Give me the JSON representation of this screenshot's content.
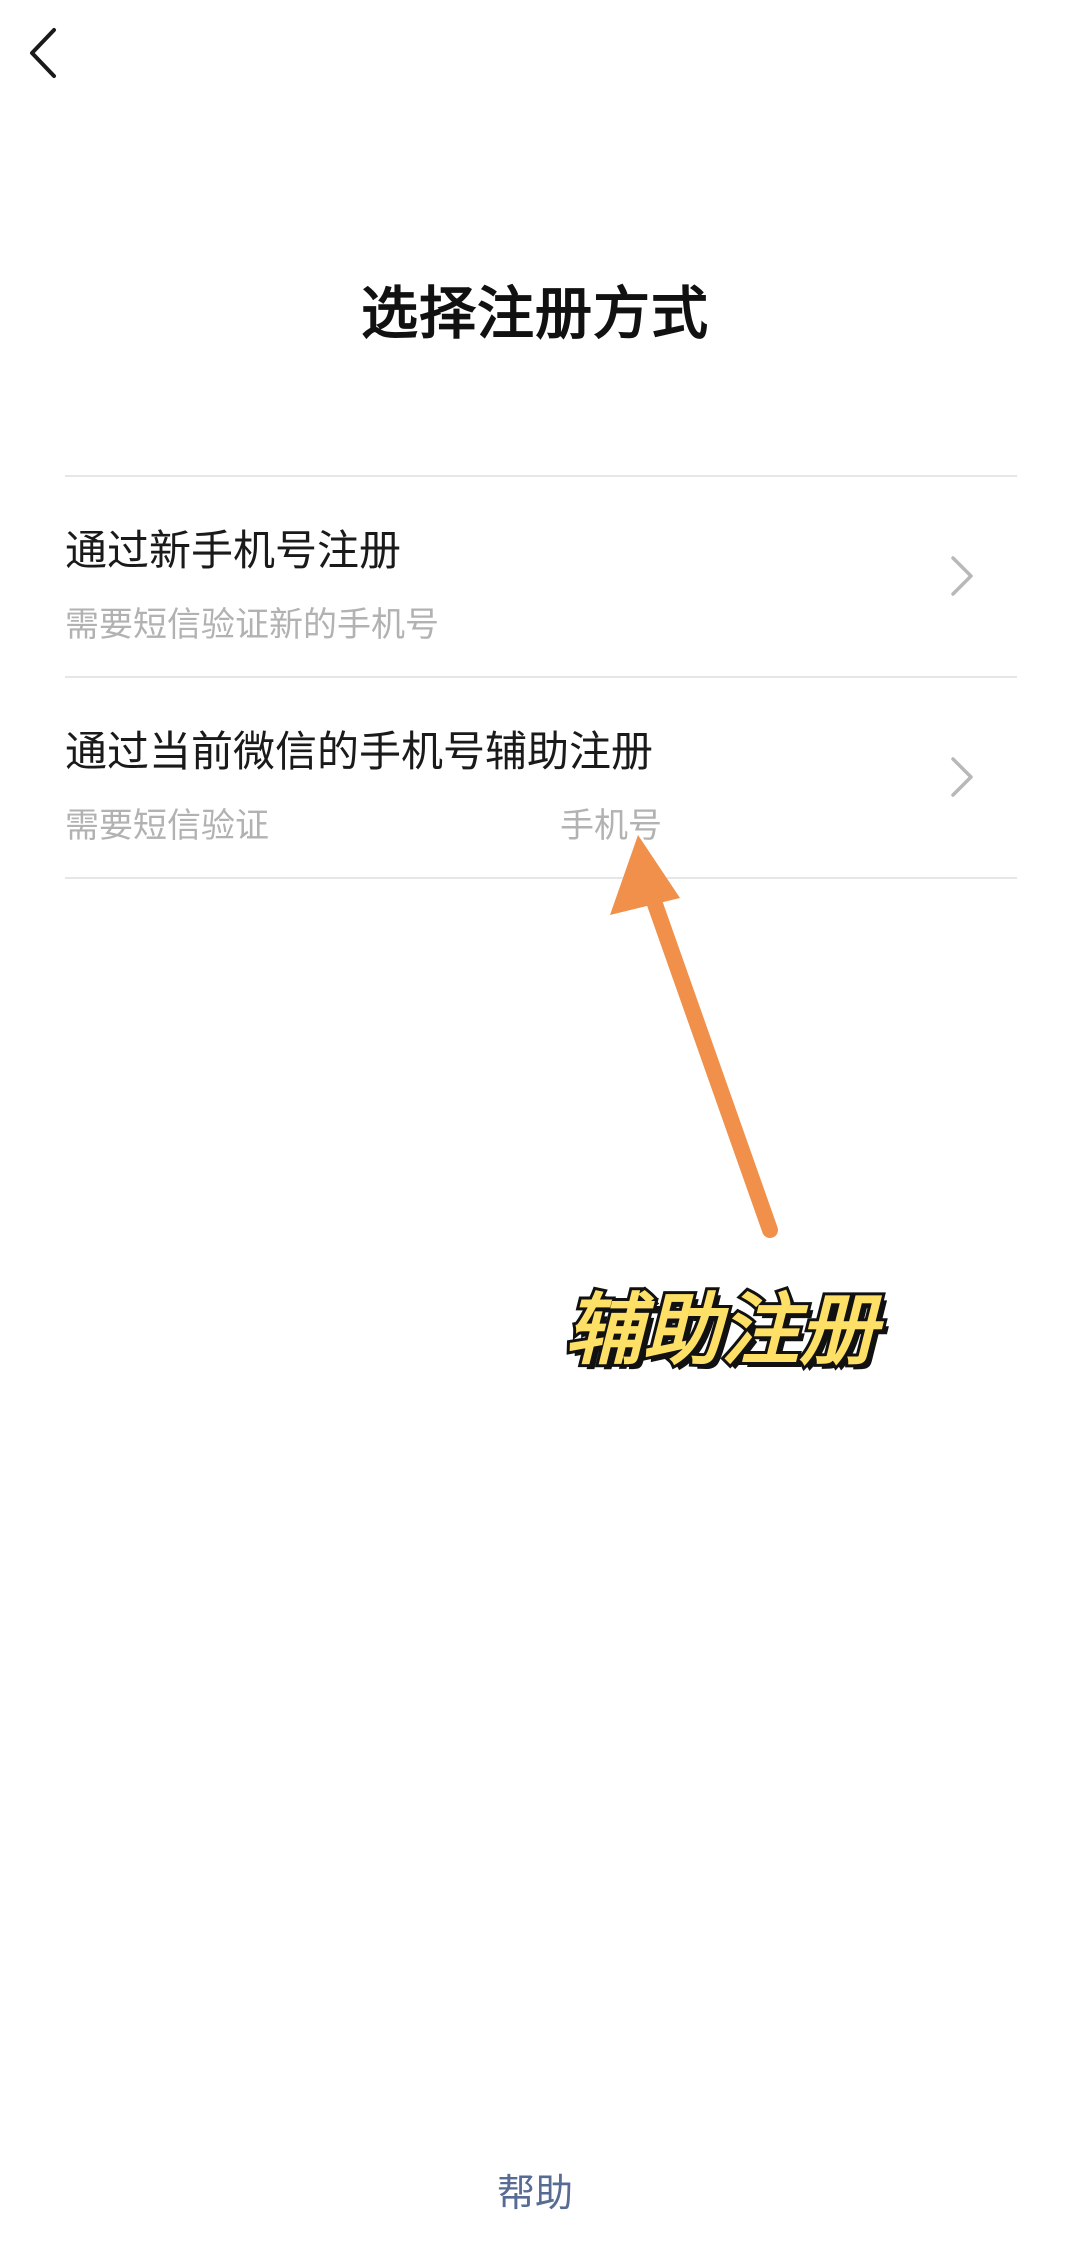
{
  "header": {
    "back_icon": "chevron-left-icon"
  },
  "title": "选择注册方式",
  "options": [
    {
      "title": "通过新手机号注册",
      "subtitle": "需要短信验证新的手机号",
      "icon": "chevron-right-icon"
    },
    {
      "title": "通过当前微信的手机号辅助注册",
      "subtitle_visible_start": "需要短信验证",
      "subtitle_visible_end": "手机号",
      "icon": "chevron-right-icon"
    }
  ],
  "annotation": {
    "label": "辅助注册",
    "arrow_color": "#f0904a",
    "label_color": "#ffe066"
  },
  "footer": {
    "help": "帮助"
  },
  "colors": {
    "link": "#576b95",
    "subtitle": "#b2b2b2",
    "divider": "#e6e6e6"
  }
}
